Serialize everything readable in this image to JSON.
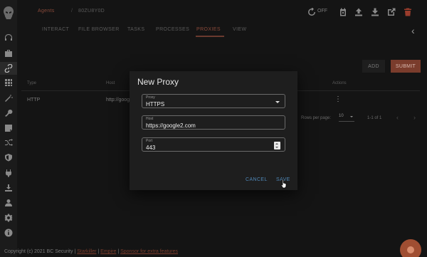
{
  "breadcrumb": {
    "agents": "Agents",
    "separator": "/",
    "current": "80ZU8Y0D"
  },
  "toolbar": {
    "auto_refresh": "OFF"
  },
  "tabs": [
    {
      "label": "INTERACT"
    },
    {
      "label": "FILE BROWSER"
    },
    {
      "label": "TASKS"
    },
    {
      "label": "PROCESSES"
    },
    {
      "label": "PROXIES"
    },
    {
      "label": "VIEW"
    }
  ],
  "active_tab": "PROXIES",
  "actions": {
    "add": "ADD",
    "submit": "SUBMIT"
  },
  "table": {
    "headers": {
      "type": "Type",
      "host": "Host",
      "actions": "Actions"
    },
    "rows": [
      {
        "type": "HTTP",
        "host": "http://goog"
      }
    ]
  },
  "pagination": {
    "rows_label": "Rows per page:",
    "rows_value": "10",
    "range": "1-1 of 1"
  },
  "footer": {
    "copyright": "Copyright (c) 2021 BC Security |",
    "link1": "Starkiller",
    "sep": "|",
    "link2": "Empire",
    "link3": "Sponsor for extra features"
  },
  "modal": {
    "title": "New Proxy",
    "proxy_label": "Proxy",
    "proxy_value": "HTTPS",
    "host_label": "Host",
    "host_value": "https://google2.com",
    "port_label": "Port",
    "port_value": "443",
    "cancel": "CANCEL",
    "save": "SAVE"
  },
  "colors": {
    "accent": "#a04e32",
    "link_blue": "#4f86b5",
    "background": "#141414"
  }
}
